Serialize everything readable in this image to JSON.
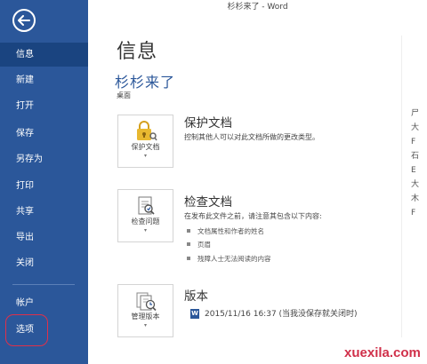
{
  "window": {
    "title": "杉杉来了 - Word"
  },
  "sidebar": {
    "items": [
      {
        "label": "信息",
        "active": true
      },
      {
        "label": "新建"
      },
      {
        "label": "打开"
      },
      {
        "label": "保存"
      },
      {
        "label": "另存为"
      },
      {
        "label": "打印"
      },
      {
        "label": "共享"
      },
      {
        "label": "导出"
      },
      {
        "label": "关闭"
      },
      {
        "label": "帐户"
      },
      {
        "label": "选项",
        "highlighted": true
      }
    ]
  },
  "main": {
    "page_title": "信息",
    "doc_name": "杉杉来了",
    "doc_location": "桌面",
    "protect": {
      "tile_label": "保护文档",
      "title": "保护文档",
      "desc": "控制其他人可以对此文档所做的更改类型。"
    },
    "inspect": {
      "tile_label": "检查问题",
      "title": "检查文档",
      "desc": "在发布此文件之前，请注意其包含以下内容:",
      "bullets": [
        "文档属性和作者的姓名",
        "页眉",
        "残障人士无法阅读的内容"
      ]
    },
    "versions": {
      "tile_label": "管理版本",
      "title": "版本",
      "entry": "2015/11/16 16:37 (当我没保存就关闭时)"
    },
    "caret": "▾",
    "right_strip": [
      "尸",
      "大",
      "F",
      "石",
      "E",
      "大",
      "木",
      "F"
    ]
  },
  "watermark": "xuexila.com",
  "colors": {
    "sidebar": "#2b579a",
    "sidebar_active": "#1a4480",
    "accent": "#2b579a",
    "highlight_ring": "#e0304a"
  }
}
